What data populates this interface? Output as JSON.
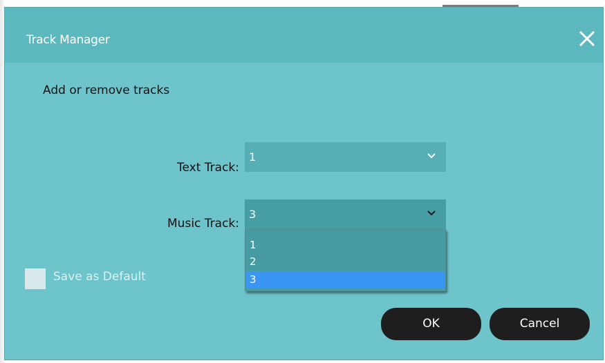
{
  "dialog": {
    "title": "Track Manager",
    "instruction": "Add or remove tracks"
  },
  "fields": {
    "text_track": {
      "label": "Text Track:",
      "value": "1"
    },
    "music_track": {
      "label": "Music Track:",
      "value": "3",
      "options": [
        "1",
        "2",
        "3"
      ],
      "selected_option": "3"
    }
  },
  "save_default": {
    "label": "Save as Default",
    "checked": false
  },
  "buttons": {
    "ok_label": "OK",
    "cancel_label": "Cancel"
  },
  "icons": {
    "close": "close-icon",
    "chevron": "chevron-down-icon"
  },
  "colors": {
    "dialog_bg": "#6ec4cb",
    "title_bar_bg": "#5cb8bf",
    "select_bg": "#55afb5",
    "dropdown_bg": "#479ca3",
    "highlight": "#3a96f2",
    "button_bg": "#1e1e1e"
  }
}
